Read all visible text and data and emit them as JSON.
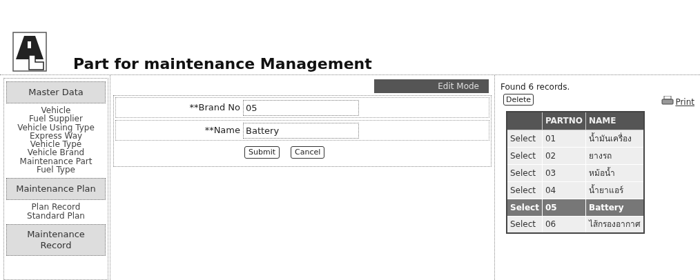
{
  "header": {
    "title": "Part for maintenance Management"
  },
  "sidebar": {
    "sections": [
      {
        "heading": "Master Data",
        "items": [
          "Vehicle",
          "Fuel Supplier",
          "Vehicle Using Type",
          "Express Way",
          "Vehicle Type",
          "Vehicle Brand",
          "Maintenance Part",
          "Fuel Type"
        ]
      },
      {
        "heading": "Maintenance Plan",
        "items": [
          "Plan Record",
          "Standard Plan"
        ]
      },
      {
        "heading": "Maintenance Record"
      }
    ]
  },
  "form": {
    "mode": "Edit Mode",
    "fields": [
      {
        "label": "**Brand No",
        "value": "05"
      },
      {
        "label": "**Name",
        "value": "Battery"
      }
    ],
    "buttons": [
      "Submit",
      "Cancel"
    ]
  },
  "results": {
    "summary": "Found 6 records.",
    "delete_button": "Delete",
    "print_link": "Print",
    "columns": [
      "PARTNO",
      "NAME"
    ],
    "rows": [
      {
        "action": "Select",
        "partno": "01",
        "name": "น้ำมันเครื่อง",
        "selected": false
      },
      {
        "action": "Select",
        "partno": "02",
        "name": "ยางรถ",
        "selected": false
      },
      {
        "action": "Select",
        "partno": "03",
        "name": "หม้อน้ำ",
        "selected": false
      },
      {
        "action": "Select",
        "partno": "04",
        "name": "น้ำยาแอร์",
        "selected": false
      },
      {
        "action": "Select",
        "partno": "05",
        "name": "Battery",
        "selected": true
      },
      {
        "action": "Select",
        "partno": "06",
        "name": "ไส้กรองอากาศ",
        "selected": false
      }
    ]
  }
}
